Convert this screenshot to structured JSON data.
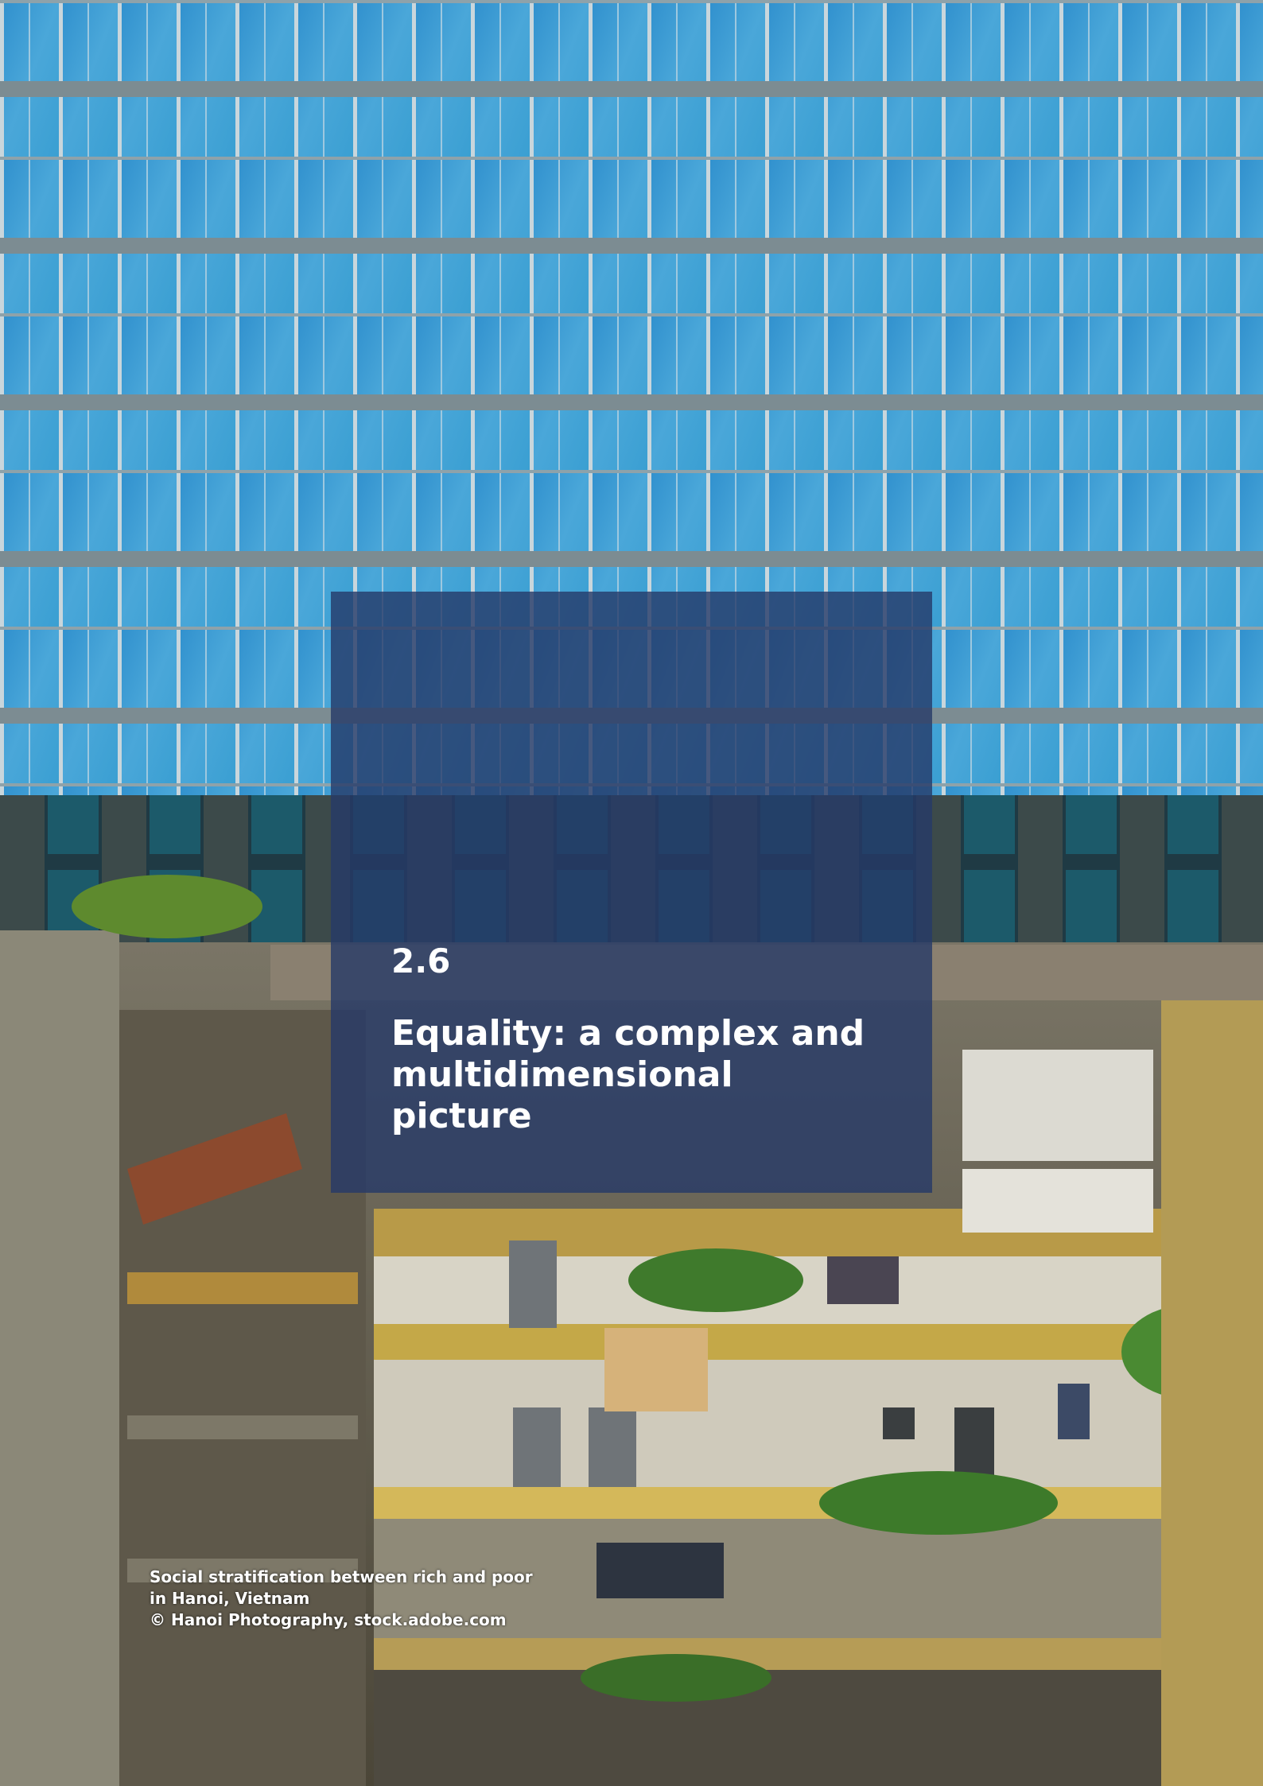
{
  "section": {
    "number": "2.6",
    "title": "Equality: a complex and multidimensional picture"
  },
  "caption": {
    "line1": "Social stratification between rich and poor",
    "line2": "in Hanoi, Vietnam",
    "line3": "© Hanoi Photography, stock.adobe.com"
  },
  "colors": {
    "overlay": "#263a68",
    "glass_tower": "#3f9ad0",
    "text": "#ffffff"
  }
}
